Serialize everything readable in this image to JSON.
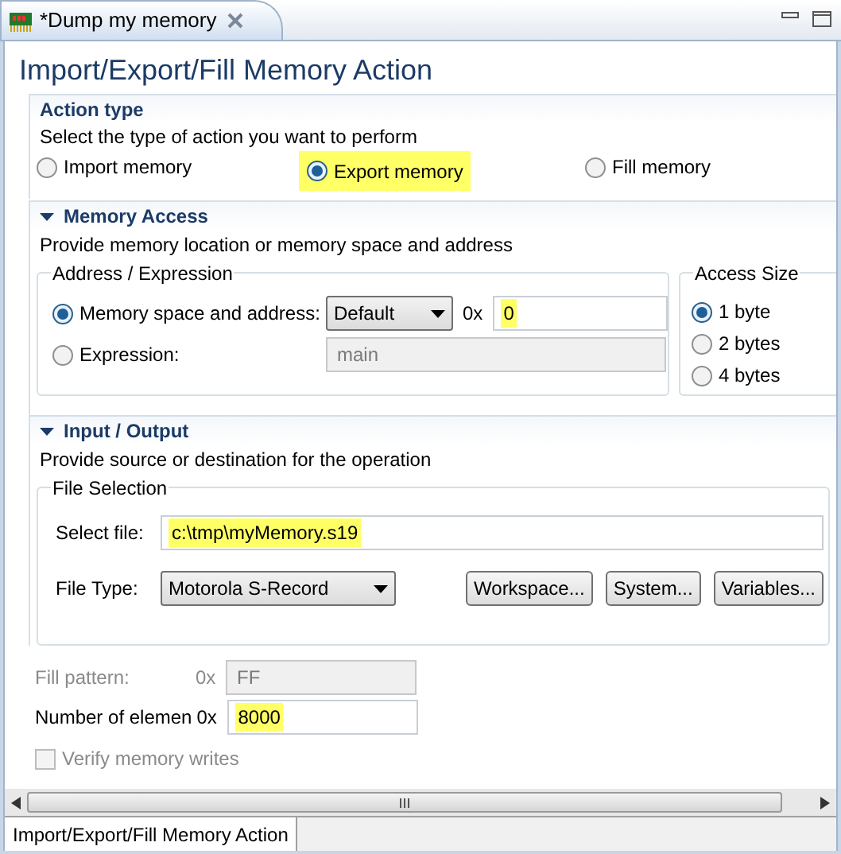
{
  "editor_tab": {
    "title": "*Dump my memory"
  },
  "page_title": "Import/Export/Fill Memory Action",
  "action_type": {
    "title": "Action type",
    "description": "Select the type of action you want to perform",
    "options": [
      {
        "label": "Import memory",
        "selected": false,
        "highlighted": false
      },
      {
        "label": "Export memory",
        "selected": true,
        "highlighted": true
      },
      {
        "label": "Fill memory",
        "selected": false,
        "highlighted": false
      }
    ]
  },
  "memory_access": {
    "title": "Memory Access",
    "expanded": true,
    "description": "Provide memory location or memory space and address",
    "address_group": {
      "title": "Address / Expression",
      "space_option": {
        "label": "Memory space and address:",
        "selected": true
      },
      "space_dropdown": "Default",
      "prefix": "0x",
      "address": {
        "value": "0",
        "highlighted": true
      },
      "expression_option": {
        "label": "Expression:",
        "selected": false
      },
      "expression": {
        "value": "main",
        "disabled": true
      }
    },
    "access_size": {
      "title": "Access Size",
      "options": [
        {
          "label": "1 byte",
          "selected": true
        },
        {
          "label": "2 bytes",
          "selected": false
        },
        {
          "label": "4 bytes",
          "selected": false
        }
      ]
    }
  },
  "input_output": {
    "title": "Input / Output",
    "expanded": true,
    "description": "Provide source or destination for the operation",
    "file_group": {
      "title": "File Selection",
      "file_label": "Select file:",
      "file": {
        "value": "c:\\tmp\\myMemory.s19",
        "highlighted": true
      },
      "type_label": "File Type:",
      "file_type": "Motorola S-Record",
      "buttons": [
        "Workspace...",
        "System...",
        "Variables..."
      ]
    }
  },
  "fill_pattern": {
    "label": "Fill pattern:",
    "prefix": "0x",
    "value": "FF",
    "disabled": true
  },
  "element_count": {
    "label": "Number of elemen",
    "prefix": "0x",
    "value": "8000",
    "highlighted": true,
    "disabled": false
  },
  "verify": {
    "label": "Verify memory writes",
    "checked": false,
    "disabled": true
  },
  "bottom_tabs": [
    {
      "label": "Import/Export/Fill Memory Action",
      "selected": true
    }
  ]
}
